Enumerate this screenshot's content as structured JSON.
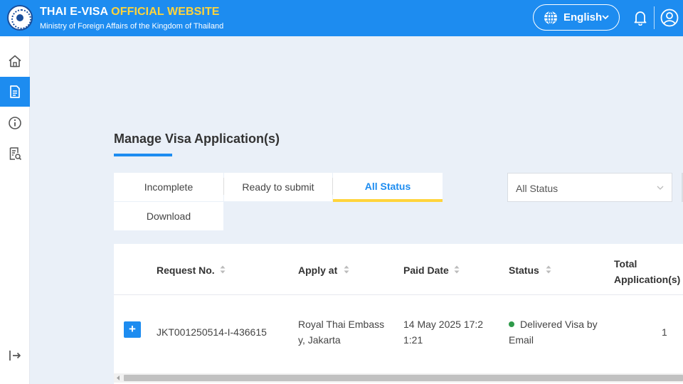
{
  "header": {
    "title_main": "THAI E-VISA",
    "title_accent": "OFFICIAL WEBSITE",
    "subtitle": "Ministry of Foreign Affairs of the Kingdom of Thailand",
    "language": "English",
    "brand_color": "#1d8cf0",
    "accent_color": "#ffd43b"
  },
  "sidebar": {
    "items": [
      {
        "icon": "home-icon",
        "active": false
      },
      {
        "icon": "document-icon",
        "active": true
      },
      {
        "icon": "info-icon",
        "active": false
      },
      {
        "icon": "receipt-search-icon",
        "active": false
      },
      {
        "icon": "logout-icon",
        "active": false
      }
    ]
  },
  "main": {
    "title": "Manage Visa Application(s)",
    "tabs": [
      {
        "label": "Incomplete",
        "active": false
      },
      {
        "label": "Ready to submit",
        "active": false
      },
      {
        "label": "All Status",
        "active": true
      },
      {
        "label": "Download",
        "active": false
      }
    ],
    "status_filter": {
      "selected": "All Status"
    }
  },
  "table": {
    "columns": [
      "Request No.",
      "Apply at",
      "Paid Date",
      "Status",
      "Total Application(s)"
    ],
    "rows": [
      {
        "expand_label": "+",
        "request_no": "JKT001250514-I-436615",
        "apply_at": "Royal Thai Embassy, Jakarta",
        "paid_date": "14 May 2025 17:21:21",
        "status": "Delivered Visa by Email",
        "status_color": "#2e9a4a",
        "total": "1"
      }
    ]
  }
}
